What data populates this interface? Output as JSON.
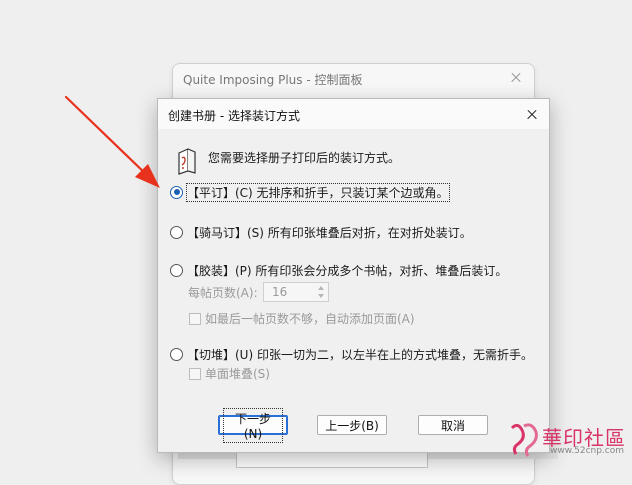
{
  "background_window": {
    "title": "Quite Imposing Plus - 控制面板"
  },
  "dialog": {
    "title": "创建书册 - 选择装订方式",
    "intro": "您需要选择册子打印后的装订方式。",
    "options": [
      {
        "label": "【平订】(C) 无排序和折手，只装订某个边或角。",
        "checked": true
      },
      {
        "label": "【骑马订】(S) 所有印张堆叠后对折，在对折处装订。",
        "checked": false
      },
      {
        "label": "【胶装】(P) 所有印张会分成多个书帖，对折、堆叠后装订。",
        "checked": false
      },
      {
        "label": "【切堆】(U) 印张一切为二，以左半在上的方式堆叠，无需折手。",
        "checked": false
      }
    ],
    "signature_label": "每帖页数(A):",
    "signature_value": "16",
    "auto_add_pages_label": "如最后一帖页数不够，自动添加页面(A)",
    "single_stack_label": "单面堆叠(S)",
    "buttons": {
      "next": "下一步(N)",
      "back": "上一步(B)",
      "cancel": "取消"
    }
  },
  "watermark": {
    "text": "華印社區",
    "url": "www.52cnp.com"
  },
  "colors": {
    "accent": "#1a5fb4",
    "arrow": "#e8321e",
    "watermark": "#d93468"
  }
}
